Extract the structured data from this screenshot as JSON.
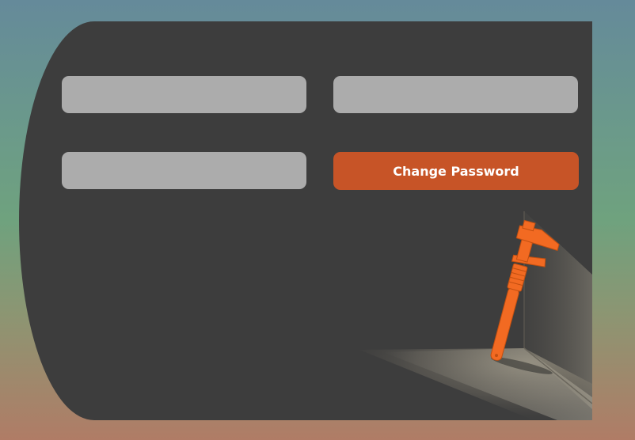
{
  "form": {
    "field_1_placeholder": "",
    "field_2_placeholder": "",
    "field_3_placeholder": "",
    "submit_label": "Change Password"
  },
  "illustration": {
    "icon": "wrench-icon",
    "accent_color": "#f26a22"
  },
  "colors": {
    "card": "#3d3d3d",
    "field": "#acacac",
    "button": "#c75427"
  }
}
